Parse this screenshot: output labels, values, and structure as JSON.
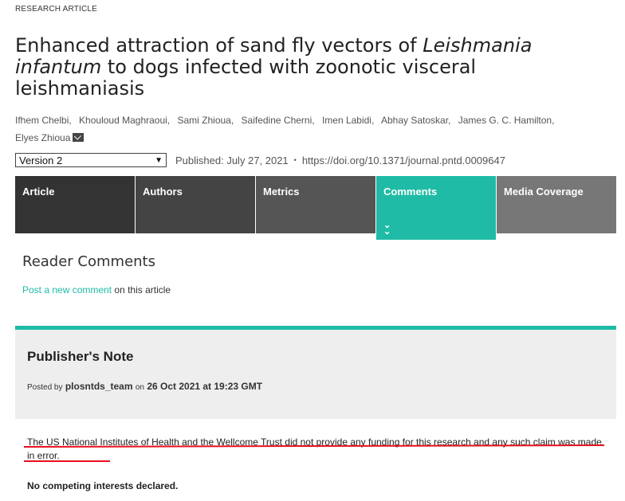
{
  "article_type": "RESEARCH ARTICLE",
  "title": {
    "part1": "Enhanced attraction of sand fly vectors of ",
    "italic1": "Leishmania infantum",
    "part2": " to dogs infected with zoonotic visceral leishmaniasis"
  },
  "authors": [
    "Ifhem Chelbi,",
    "Khouloud Maghraoui,",
    "Sami Zhioua,",
    "Saifedine Cherni,",
    "Imen Labidi,",
    "Abhay Satoskar,",
    "James G. C. Hamilton,",
    "Elyes Zhioua"
  ],
  "meta": {
    "version": "Version 2",
    "published": "Published: July 27, 2021",
    "separator": "•",
    "doi": "https://doi.org/10.1371/journal.pntd.0009647"
  },
  "tabs": [
    {
      "label": "Article"
    },
    {
      "label": "Authors"
    },
    {
      "label": "Metrics"
    },
    {
      "label": "Comments"
    },
    {
      "label": "Media Coverage"
    }
  ],
  "comments": {
    "heading": "Reader Comments",
    "post_link": "Post a new comment",
    "post_suffix": " on this article"
  },
  "note": {
    "title": "Publisher's Note",
    "posted_by": "Posted by",
    "author": "plosntds_team",
    "on": "on",
    "datetime": "26 Oct 2021 at 19:23 GMT",
    "body": "The US National Institutes of Health and the Wellcome Trust did not provide any funding for this research and any such claim was made in error.",
    "competing": "No competing interests declared."
  },
  "colors": {
    "accent": "#1fbba6",
    "highlight_underline": "#e8101e"
  }
}
